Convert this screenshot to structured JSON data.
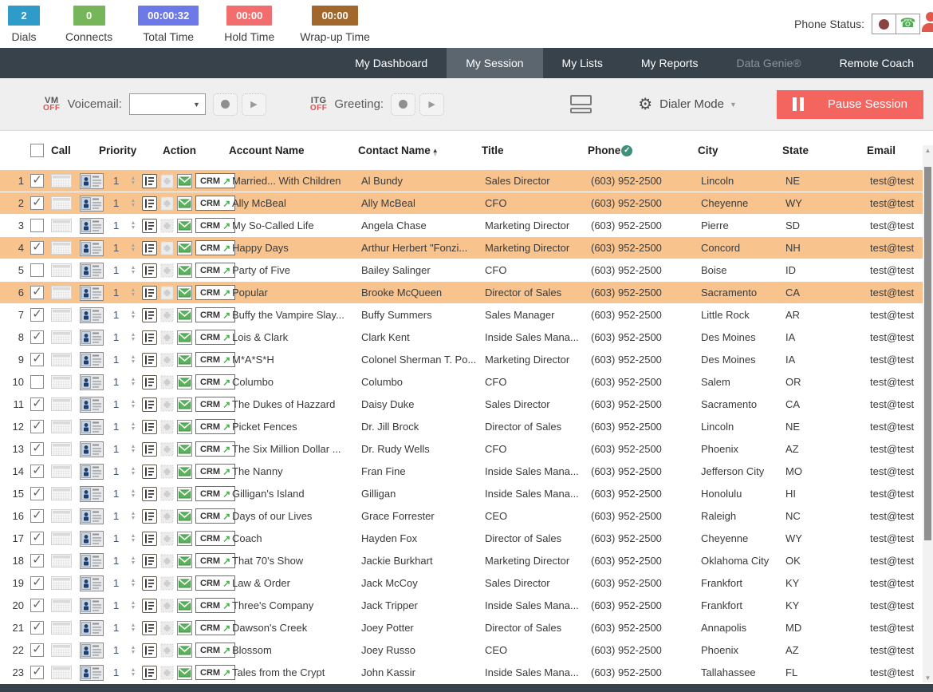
{
  "stats": {
    "items": [
      {
        "value": "2",
        "label": "Dials",
        "color": "#2E9BC9"
      },
      {
        "value": "0",
        "label": "Connects",
        "color": "#77B55A"
      },
      {
        "value": "00:00:32",
        "label": "Total Time",
        "color": "#6E79E8"
      },
      {
        "value": "00:00",
        "label": "Hold Time",
        "color": "#F26D6D"
      },
      {
        "value": "00:00",
        "label": "Wrap-up Time",
        "color": "#A2672A"
      }
    ],
    "phone_status_label": "Phone Status:"
  },
  "nav": {
    "tabs": [
      {
        "label": "My Dashboard"
      },
      {
        "label": "My Session"
      },
      {
        "label": "My Lists"
      },
      {
        "label": "My Reports"
      },
      {
        "label": "Data Genie®"
      },
      {
        "label": "Remote Coach"
      }
    ]
  },
  "toolbar": {
    "vm_badge_top": "VM",
    "vm_badge_bottom": "OFF",
    "voicemail_label": "Voicemail:",
    "voicemail_value": "",
    "itg_badge_top": "ITG",
    "itg_badge_bottom": "OFF",
    "greeting_label": "Greeting:",
    "dialer_mode_label": "Dialer Mode",
    "pause_button_label": "Pause Session"
  },
  "table": {
    "headers": {
      "call": "Call",
      "priority": "Priority",
      "action": "Action",
      "account": "Account Name",
      "contact": "Contact Name",
      "title": "Title",
      "phone": "Phone",
      "city": "City",
      "state": "State",
      "email": "Email"
    },
    "crm_label": "CRM",
    "rows": [
      {
        "num": "1",
        "checked": true,
        "highlighted": true,
        "priority": "1",
        "account": "Married... With Children",
        "contact": "Al Bundy",
        "title": "Sales Director",
        "phone": "(603) 952-2500",
        "city": "Lincoln",
        "state": "NE",
        "email": "test@test"
      },
      {
        "num": "2",
        "checked": true,
        "highlighted": true,
        "priority": "1",
        "account": "Ally McBeal",
        "contact": "Ally McBeal",
        "title": "CFO",
        "phone": "(603) 952-2500",
        "city": "Cheyenne",
        "state": "WY",
        "email": "test@test"
      },
      {
        "num": "3",
        "checked": false,
        "highlighted": false,
        "priority": "1",
        "account": "My So-Called Life",
        "contact": "Angela Chase",
        "title": "Marketing Director",
        "phone": "(603) 952-2500",
        "city": "Pierre",
        "state": "SD",
        "email": "test@test"
      },
      {
        "num": "4",
        "checked": true,
        "highlighted": true,
        "priority": "1",
        "account": "Happy Days",
        "contact": "Arthur Herbert \"Fonzi...",
        "title": "Marketing Director",
        "phone": "(603) 952-2500",
        "city": "Concord",
        "state": "NH",
        "email": "test@test"
      },
      {
        "num": "5",
        "checked": false,
        "highlighted": false,
        "priority": "1",
        "account": "Party of Five",
        "contact": "Bailey Salinger",
        "title": "CFO",
        "phone": "(603) 952-2500",
        "city": "Boise",
        "state": "ID",
        "email": "test@test"
      },
      {
        "num": "6",
        "checked": true,
        "highlighted": true,
        "priority": "1",
        "account": "Popular",
        "contact": "Brooke McQueen",
        "title": "Director of Sales",
        "phone": "(603) 952-2500",
        "city": "Sacramento",
        "state": "CA",
        "email": "test@test"
      },
      {
        "num": "7",
        "checked": true,
        "highlighted": false,
        "priority": "1",
        "account": "Buffy the Vampire Slay...",
        "contact": "Buffy Summers",
        "title": "Sales Manager",
        "phone": "(603) 952-2500",
        "city": "Little Rock",
        "state": "AR",
        "email": "test@test"
      },
      {
        "num": "8",
        "checked": true,
        "highlighted": false,
        "priority": "1",
        "account": "Lois & Clark",
        "contact": "Clark Kent",
        "title": "Inside Sales Mana...",
        "phone": "(603) 952-2500",
        "city": "Des Moines",
        "state": "IA",
        "email": "test@test"
      },
      {
        "num": "9",
        "checked": true,
        "highlighted": false,
        "priority": "1",
        "account": "M*A*S*H",
        "contact": "Colonel Sherman T. Po...",
        "title": "Marketing Director",
        "phone": "(603) 952-2500",
        "city": "Des Moines",
        "state": "IA",
        "email": "test@test"
      },
      {
        "num": "10",
        "checked": false,
        "highlighted": false,
        "priority": "1",
        "account": "Columbo",
        "contact": "Columbo",
        "title": "CFO",
        "phone": "(603) 952-2500",
        "city": "Salem",
        "state": "OR",
        "email": "test@test"
      },
      {
        "num": "11",
        "checked": true,
        "highlighted": false,
        "priority": "1",
        "account": "The Dukes of Hazzard",
        "contact": "Daisy Duke",
        "title": "Sales Director",
        "phone": "(603) 952-2500",
        "city": "Sacramento",
        "state": "CA",
        "email": "test@test"
      },
      {
        "num": "12",
        "checked": true,
        "highlighted": false,
        "priority": "1",
        "account": "Picket Fences",
        "contact": "Dr. Jill Brock",
        "title": "Director of Sales",
        "phone": "(603) 952-2500",
        "city": "Lincoln",
        "state": "NE",
        "email": "test@test"
      },
      {
        "num": "13",
        "checked": true,
        "highlighted": false,
        "priority": "1",
        "account": "The Six Million Dollar ...",
        "contact": "Dr. Rudy Wells",
        "title": "CFO",
        "phone": "(603) 952-2500",
        "city": "Phoenix",
        "state": "AZ",
        "email": "test@test"
      },
      {
        "num": "14",
        "checked": true,
        "highlighted": false,
        "priority": "1",
        "account": "The Nanny",
        "contact": "Fran Fine",
        "title": "Inside Sales Mana...",
        "phone": "(603) 952-2500",
        "city": "Jefferson City",
        "state": "MO",
        "email": "test@test"
      },
      {
        "num": "15",
        "checked": true,
        "highlighted": false,
        "priority": "1",
        "account": "Gilligan's Island",
        "contact": "Gilligan",
        "title": "Inside Sales Mana...",
        "phone": "(603) 952-2500",
        "city": "Honolulu",
        "state": "HI",
        "email": "test@test"
      },
      {
        "num": "16",
        "checked": true,
        "highlighted": false,
        "priority": "1",
        "account": "Days of our Lives",
        "contact": "Grace Forrester",
        "title": "CEO",
        "phone": "(603) 952-2500",
        "city": "Raleigh",
        "state": "NC",
        "email": "test@test"
      },
      {
        "num": "17",
        "checked": true,
        "highlighted": false,
        "priority": "1",
        "account": "Coach",
        "contact": "Hayden Fox",
        "title": "Director of Sales",
        "phone": "(603) 952-2500",
        "city": "Cheyenne",
        "state": "WY",
        "email": "test@test"
      },
      {
        "num": "18",
        "checked": true,
        "highlighted": false,
        "priority": "1",
        "account": "That 70's Show",
        "contact": "Jackie Burkhart",
        "title": "Marketing Director",
        "phone": "(603) 952-2500",
        "city": "Oklahoma City",
        "state": "OK",
        "email": "test@test"
      },
      {
        "num": "19",
        "checked": true,
        "highlighted": false,
        "priority": "1",
        "account": "Law & Order",
        "contact": "Jack McCoy",
        "title": "Sales Director",
        "phone": "(603) 952-2500",
        "city": "Frankfort",
        "state": "KY",
        "email": "test@test"
      },
      {
        "num": "20",
        "checked": true,
        "highlighted": false,
        "priority": "1",
        "account": "Three's Company",
        "contact": "Jack Tripper",
        "title": "Inside Sales Mana...",
        "phone": "(603) 952-2500",
        "city": "Frankfort",
        "state": "KY",
        "email": "test@test"
      },
      {
        "num": "21",
        "checked": true,
        "highlighted": false,
        "priority": "1",
        "account": "Dawson's Creek",
        "contact": "Joey Potter",
        "title": "Director of Sales",
        "phone": "(603) 952-2500",
        "city": "Annapolis",
        "state": "MD",
        "email": "test@test"
      },
      {
        "num": "22",
        "checked": true,
        "highlighted": false,
        "priority": "1",
        "account": "Blossom",
        "contact": "Joey Russo",
        "title": "CEO",
        "phone": "(603) 952-2500",
        "city": "Phoenix",
        "state": "AZ",
        "email": "test@test"
      },
      {
        "num": "23",
        "checked": true,
        "highlighted": false,
        "priority": "1",
        "account": "Tales from the Crypt",
        "contact": "John Kassir",
        "title": "Inside Sales Mana...",
        "phone": "(603) 952-2500",
        "city": "Tallahassee",
        "state": "FL",
        "email": "test@test"
      }
    ]
  },
  "colors": {
    "row_highlight": "#F9C38E",
    "pause_button": "#F4655F",
    "nav_bg": "#38424A",
    "phone_check": "#3E8F7C",
    "crm_arrow_green": "#4CAF50"
  }
}
